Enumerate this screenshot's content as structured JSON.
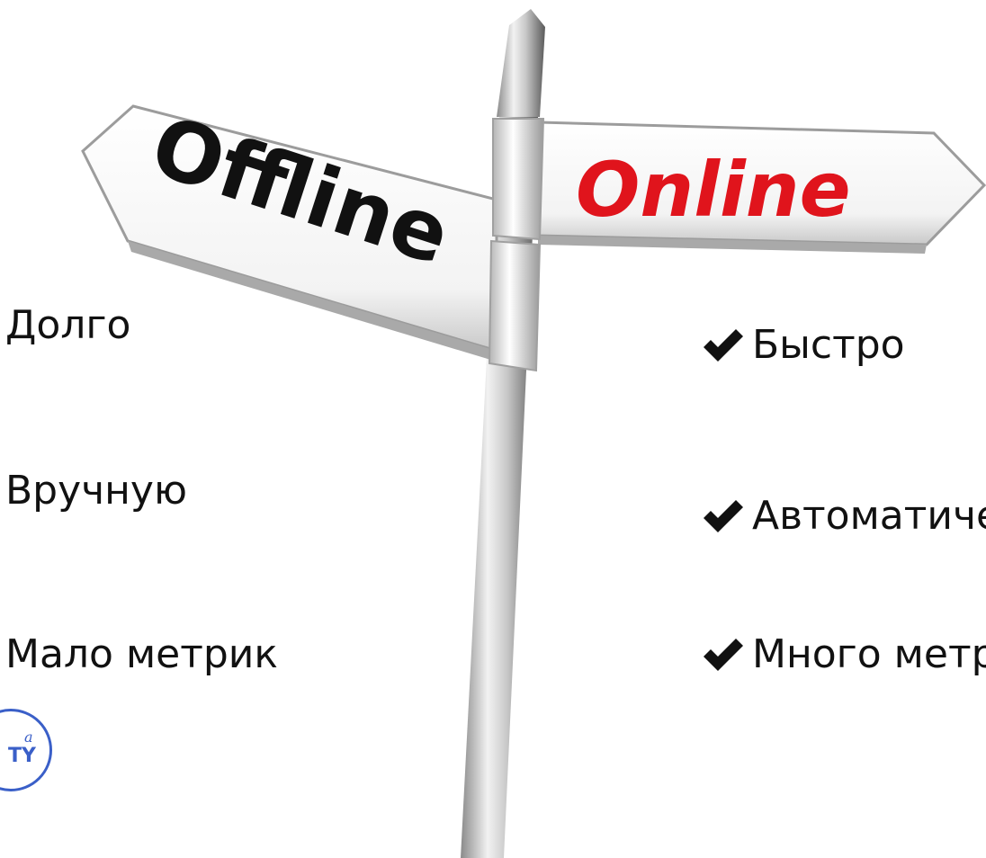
{
  "signs": {
    "left_label": "Offline",
    "right_label": "Online",
    "left_color": "#111111",
    "right_color": "#e0141c"
  },
  "left_list": {
    "items": [
      "Долго",
      "Вручную",
      "Мало метрик"
    ]
  },
  "right_list": {
    "check_icon": "checkmark-icon",
    "items": [
      "Быстро",
      "Автоматически",
      "Много метрик"
    ]
  },
  "logo": {
    "text_small": "a",
    "text_main": "TY",
    "color": "#3a5fc8"
  }
}
